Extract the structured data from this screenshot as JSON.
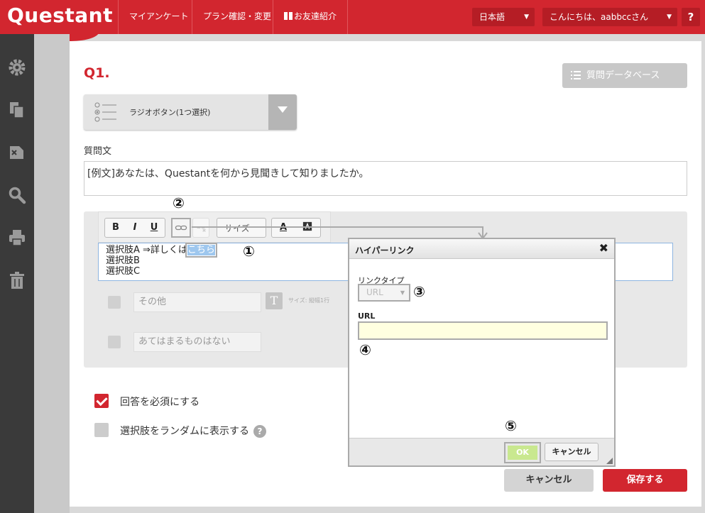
{
  "header": {
    "logo": "Questant",
    "nav": [
      "マイアンケート",
      "プラン確認・変更",
      "お友達紹介"
    ],
    "language": "日本語",
    "greeting": "こんにちは、aabbccさん",
    "help": "?"
  },
  "sidebar": {
    "icons": [
      "gear-icon",
      "copy-icon",
      "share-icon",
      "search-icon",
      "print-icon",
      "trash-icon"
    ]
  },
  "question": {
    "number": "Q1.",
    "db_button": "質問データベース",
    "type": "ラジオボタン(1つ選択)",
    "text_label": "質問文",
    "text": "[例文]あなたは、Questantを何から見聞きして知りましたか。"
  },
  "toolbar": {
    "bold": "B",
    "italic": "I",
    "underline": "U",
    "size": "サイズ",
    "font_color": "A"
  },
  "editor": {
    "line1_prefix": "選択肢A ⇒詳しくは",
    "line1_link": "こちら",
    "line2": "選択肢B",
    "line3": "選択肢C"
  },
  "options": {
    "other_placeholder": "その他",
    "none_placeholder": "あてはまるものはない",
    "t_button": "T",
    "size_note": "サイズ: 縦幅1行"
  },
  "settings": {
    "required_label": "回答を必須にする",
    "required_checked": true,
    "random_label": "選択肢をランダムに表示する",
    "random_checked": false
  },
  "footer": {
    "cancel": "キャンセル",
    "save": "保存する"
  },
  "dialog": {
    "title": "ハイパーリンク",
    "close": "✖",
    "link_type_label": "リンクタイプ",
    "link_type_value": "URL",
    "url_label": "URL",
    "url_value": "",
    "ok": "OK",
    "cancel": "キャンセル"
  },
  "markers": [
    "①",
    "②",
    "③",
    "④",
    "⑤"
  ],
  "colors": {
    "brand": "#d2262f",
    "sidebar": "#3a3a3a",
    "highlight": "#9ec7ee"
  }
}
